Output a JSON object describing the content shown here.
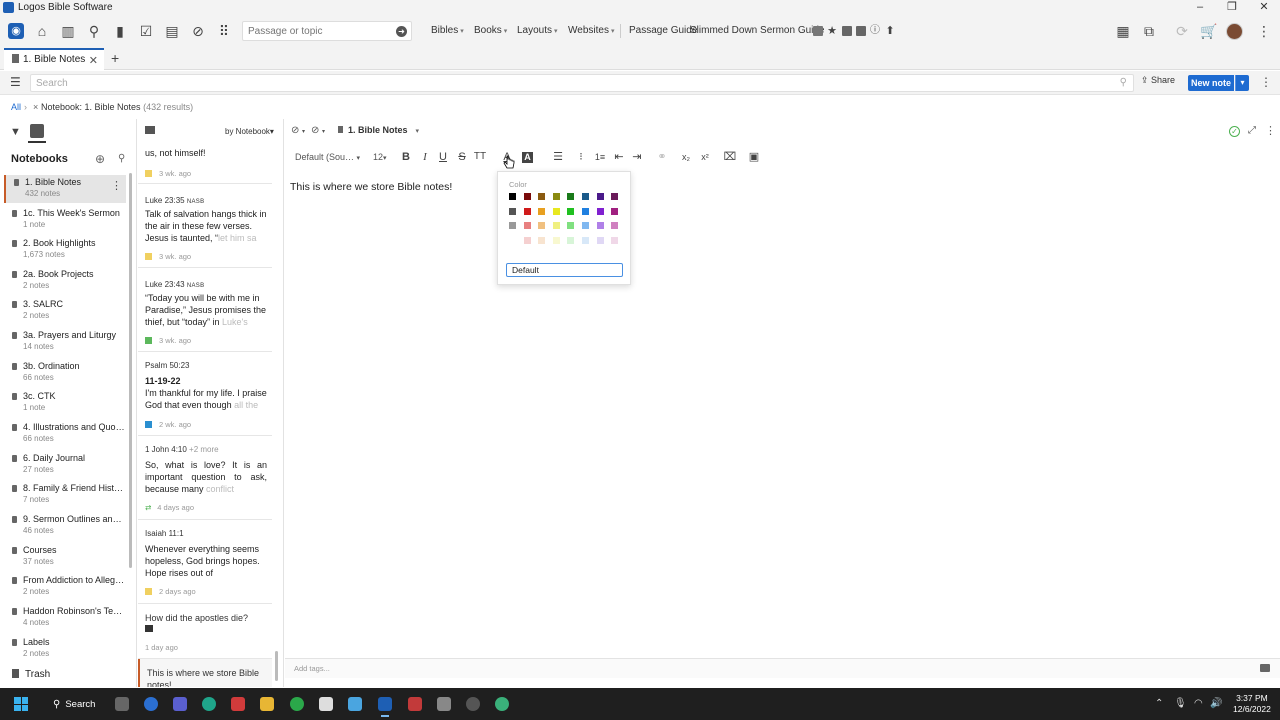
{
  "window": {
    "title": "Logos Bible Software"
  },
  "toolbar": {
    "search_placeholder": "Passage or topic",
    "menus": [
      "Bibles",
      "Books",
      "Layouts",
      "Websites"
    ],
    "guides": [
      "Passage Guide",
      "Slimmed Down Sermon Guide"
    ]
  },
  "tabs": {
    "active": "1. Bible Notes"
  },
  "searchbar": {
    "placeholder": "Search",
    "share": "Share",
    "new_note": "New note"
  },
  "breadcrumb": {
    "root": "All",
    "label": "Notebook: 1. Bible Notes",
    "count": "(432 results)"
  },
  "notebooks": {
    "heading": "Notebooks",
    "items": [
      {
        "name": "1. Bible Notes",
        "count": "432 notes"
      },
      {
        "name": "1c. This Week's Sermon",
        "count": "1 note"
      },
      {
        "name": "2. Book Highlights",
        "count": "1,673 notes"
      },
      {
        "name": "2a. Book Projects",
        "count": "2 notes"
      },
      {
        "name": "3. SALRC",
        "count": "2 notes"
      },
      {
        "name": "3a. Prayers and Liturgy",
        "count": "14 notes"
      },
      {
        "name": "3b. Ordination",
        "count": "66 notes"
      },
      {
        "name": "3c. CTK",
        "count": "1 note"
      },
      {
        "name": "4. Illustrations and Quotes",
        "count": "66 notes"
      },
      {
        "name": "6. Daily Journal",
        "count": "27 notes"
      },
      {
        "name": "8. Family & Friend History",
        "count": "7 notes"
      },
      {
        "name": "9. Sermon Outlines and S…",
        "count": "46 notes"
      },
      {
        "name": "Courses",
        "count": "37 notes"
      },
      {
        "name": "From Addiction to Allegie…",
        "count": "2 notes"
      },
      {
        "name": "Haddon Robinson's Ten …",
        "count": "4 notes"
      },
      {
        "name": "Labels",
        "count": "2 notes"
      }
    ],
    "trash": "Trash"
  },
  "notes_list": {
    "sort_label": "by Notebook",
    "partial_top": "us, not himself!",
    "partial_top_time": "3 wk. ago",
    "items": [
      {
        "ref": "Luke 23:35",
        "version": "NASB",
        "body": "Talk of salvation hangs thick in the air in these few verses. Jesus is taunted, “",
        "fade": "let him sa",
        "time": "3 wk. ago",
        "color": "#f0d060"
      },
      {
        "ref": "Luke 23:43",
        "version": "NASB",
        "body": "“Today you will be with me in Paradise,” Jesus promises the thief, but “today” in ",
        "fade": "Luke's",
        "time": "3 wk. ago",
        "color": "#5cb85c"
      },
      {
        "ref": "Psalm 50:23",
        "date": "11-19-22",
        "body": "I'm thankful for my life. I praise God that even though ",
        "fade": "all the",
        "time": "2 wk. ago",
        "color": "#2a8fd0"
      },
      {
        "ref": "1 John 4:10",
        "more": "+2 more",
        "body": "So, what is love? It is an important question to ask, because many ",
        "fade": "conflict",
        "time": "4 days ago"
      },
      {
        "ref": "Isaiah 11:1",
        "body": "Whenever everything seems hopeless, God brings hopes. Hope rises out of",
        "time": "2 days ago",
        "color": "#f0d060"
      },
      {
        "ref": "How did the apostles die?",
        "time": "1 day ago"
      },
      {
        "ref": "This is where we store Bible notes!"
      }
    ]
  },
  "editor": {
    "notebook": "1. Bible Notes",
    "font": "Default (Sou…",
    "size": "12",
    "content": "This is where we store Bible notes!",
    "tags_placeholder": "Add tags..."
  },
  "color_popup": {
    "label": "Color",
    "default_value": "Default",
    "rows": [
      [
        "#000000",
        "#7a0a0a",
        "#8a5a10",
        "#8a8a10",
        "#1a7a1a",
        "#1a5a8a",
        "#4a1a8a",
        "#6a1a5a"
      ],
      [
        "#555555",
        "#d01a1a",
        "#e8a020",
        "#e8e820",
        "#20c020",
        "#2080e0",
        "#8020d0",
        "#a02080"
      ],
      [
        "#999999",
        "#e88080",
        "#f0c080",
        "#f0f080",
        "#80e080",
        "#80b8f0",
        "#b080e8",
        "#d080c0"
      ],
      [
        "#ffffff",
        "#f5d0d0",
        "#f8e4d0",
        "#f8f8d0",
        "#d8f5d8",
        "#d8e8f8",
        "#e0d8f5",
        "#f0d8e8"
      ]
    ]
  },
  "taskbar": {
    "search": "Search",
    "time": "3:37 PM",
    "date": "12/6/2022"
  }
}
